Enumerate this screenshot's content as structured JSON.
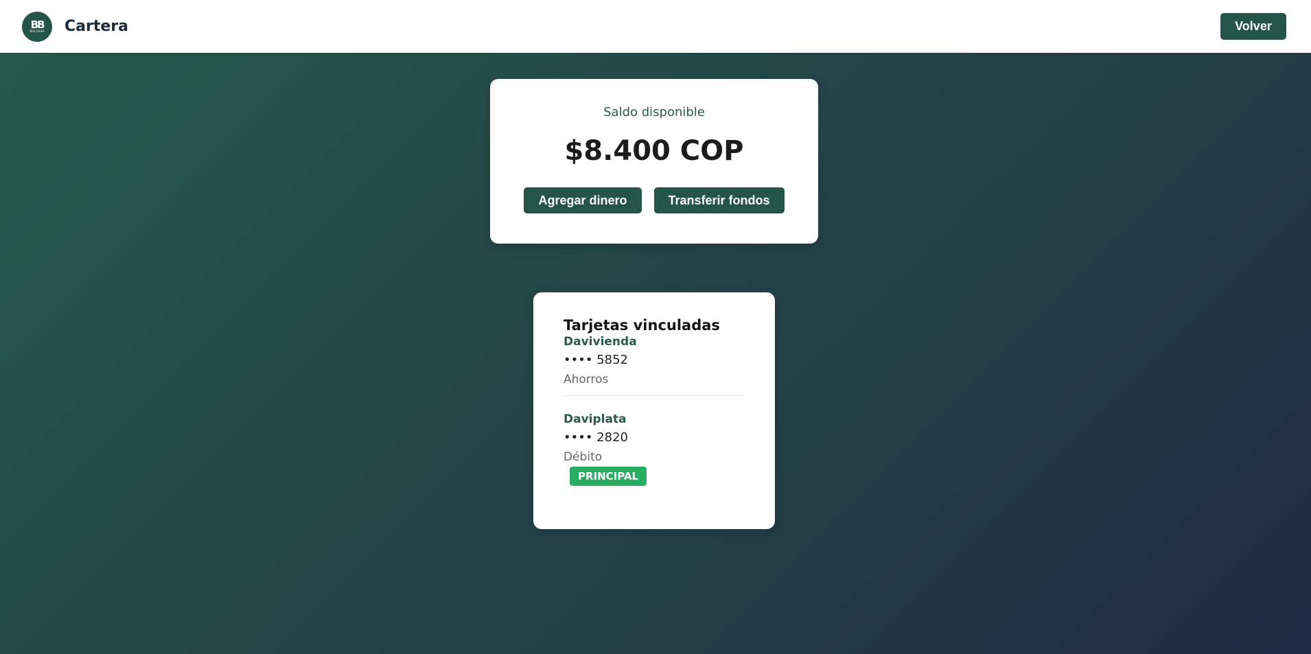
{
  "header": {
    "logo_mark": "BB",
    "logo_sub": "BILLCASH",
    "title": "Cartera",
    "back_label": "Volver"
  },
  "balance": {
    "label": "Saldo disponible",
    "amount": "$8.400 COP",
    "add_money_label": "Agregar dinero",
    "transfer_label": "Transferir fondos"
  },
  "linked_cards": {
    "title": "Tarjetas vinculadas",
    "items": [
      {
        "bank": "Davivienda",
        "number": "•••• 5852",
        "type": "Ahorros"
      },
      {
        "bank": "Daviplata",
        "number": "•••• 2820",
        "type": "Débito",
        "badge": "PRINCIPAL"
      }
    ]
  },
  "colors": {
    "brand": "#255548",
    "badge": "#27ae60",
    "bank_name": "#2a5a4b"
  }
}
